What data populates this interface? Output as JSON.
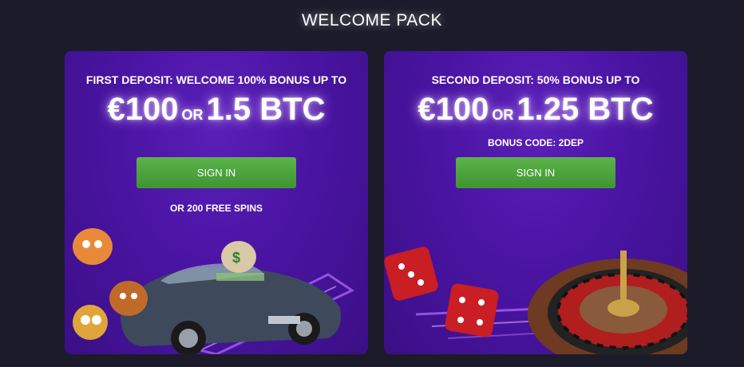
{
  "page": {
    "title": "WELCOME PACK"
  },
  "cards": [
    {
      "headline": "FIRST DEPOSIT: WELCOME 100% BONUS UP TO",
      "amount_main": "€100",
      "amount_or": "OR",
      "amount_alt": "1.5 BTC",
      "button_label": "SIGN IN",
      "extra": "OR 200 FREE SPINS"
    },
    {
      "headline": "SECOND DEPOSIT: 50% BONUS UP TO",
      "amount_main": "€100",
      "amount_or": "OR",
      "amount_alt": "1.25 BTC",
      "bonus_code": "BONUS CODE: 2DEP",
      "button_label": "SIGN IN"
    }
  ],
  "colors": {
    "background": "#1c1b2a",
    "card": "#4a14a3",
    "button": "#4ca33d"
  }
}
